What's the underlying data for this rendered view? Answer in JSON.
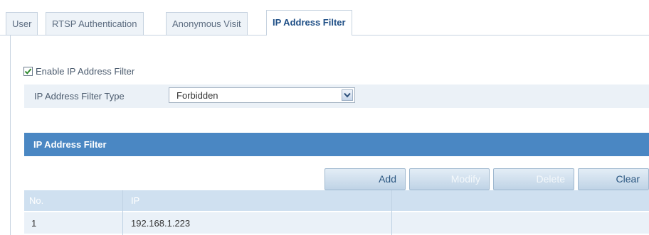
{
  "tabs": [
    {
      "label": "User",
      "active": false
    },
    {
      "label": "RTSP Authentication",
      "active": false
    },
    {
      "label": "Anonymous Visit",
      "active": false
    },
    {
      "label": "IP Address Filter",
      "active": true
    }
  ],
  "enable_filter": {
    "label": "Enable IP Address Filter",
    "checked": true
  },
  "filter_type": {
    "label": "IP Address Filter Type",
    "value": "Forbidden"
  },
  "section": {
    "title": "IP Address Filter"
  },
  "buttons": {
    "add": {
      "label": "Add",
      "enabled": true
    },
    "modify": {
      "label": "Modify",
      "enabled": false
    },
    "delete": {
      "label": "Delete",
      "enabled": false
    },
    "clear": {
      "label": "Clear",
      "enabled": true
    }
  },
  "table": {
    "columns": [
      "No.",
      "IP"
    ],
    "rows": [
      {
        "no": "1",
        "ip": "192.168.1.223"
      }
    ]
  },
  "colors": {
    "accent": "#4a87c3",
    "active_tab_text": "#1f4f86",
    "row_background": "#eaf1f8"
  },
  "icons": {
    "checkbox": "checkmark-icon",
    "select": "chevron-down-icon"
  }
}
